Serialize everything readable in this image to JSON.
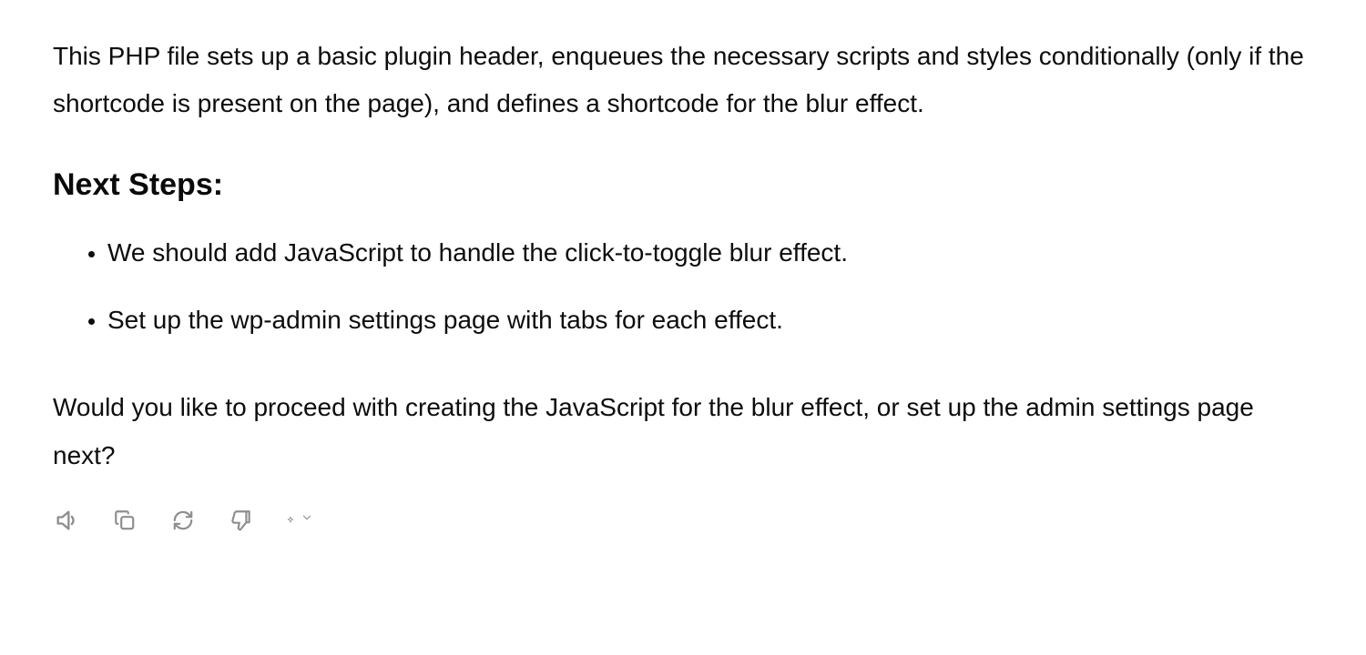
{
  "content": {
    "intro_paragraph": "This PHP file sets up a basic plugin header, enqueues the necessary scripts and styles conditionally (only if the shortcode is present on the page), and defines a shortcode for the blur effect.",
    "heading": "Next Steps:",
    "bullets": [
      "We should add JavaScript to handle the click-to-toggle blur effect.",
      "Set up the wp-admin settings page with tabs for each effect."
    ],
    "closing_paragraph": "Would you like to proceed with creating the JavaScript for the blur effect, or set up the admin settings page next?"
  },
  "toolbar": {
    "icons": [
      "speaker-icon",
      "copy-icon",
      "refresh-icon",
      "thumbs-down-icon",
      "sparkle-icon"
    ]
  }
}
